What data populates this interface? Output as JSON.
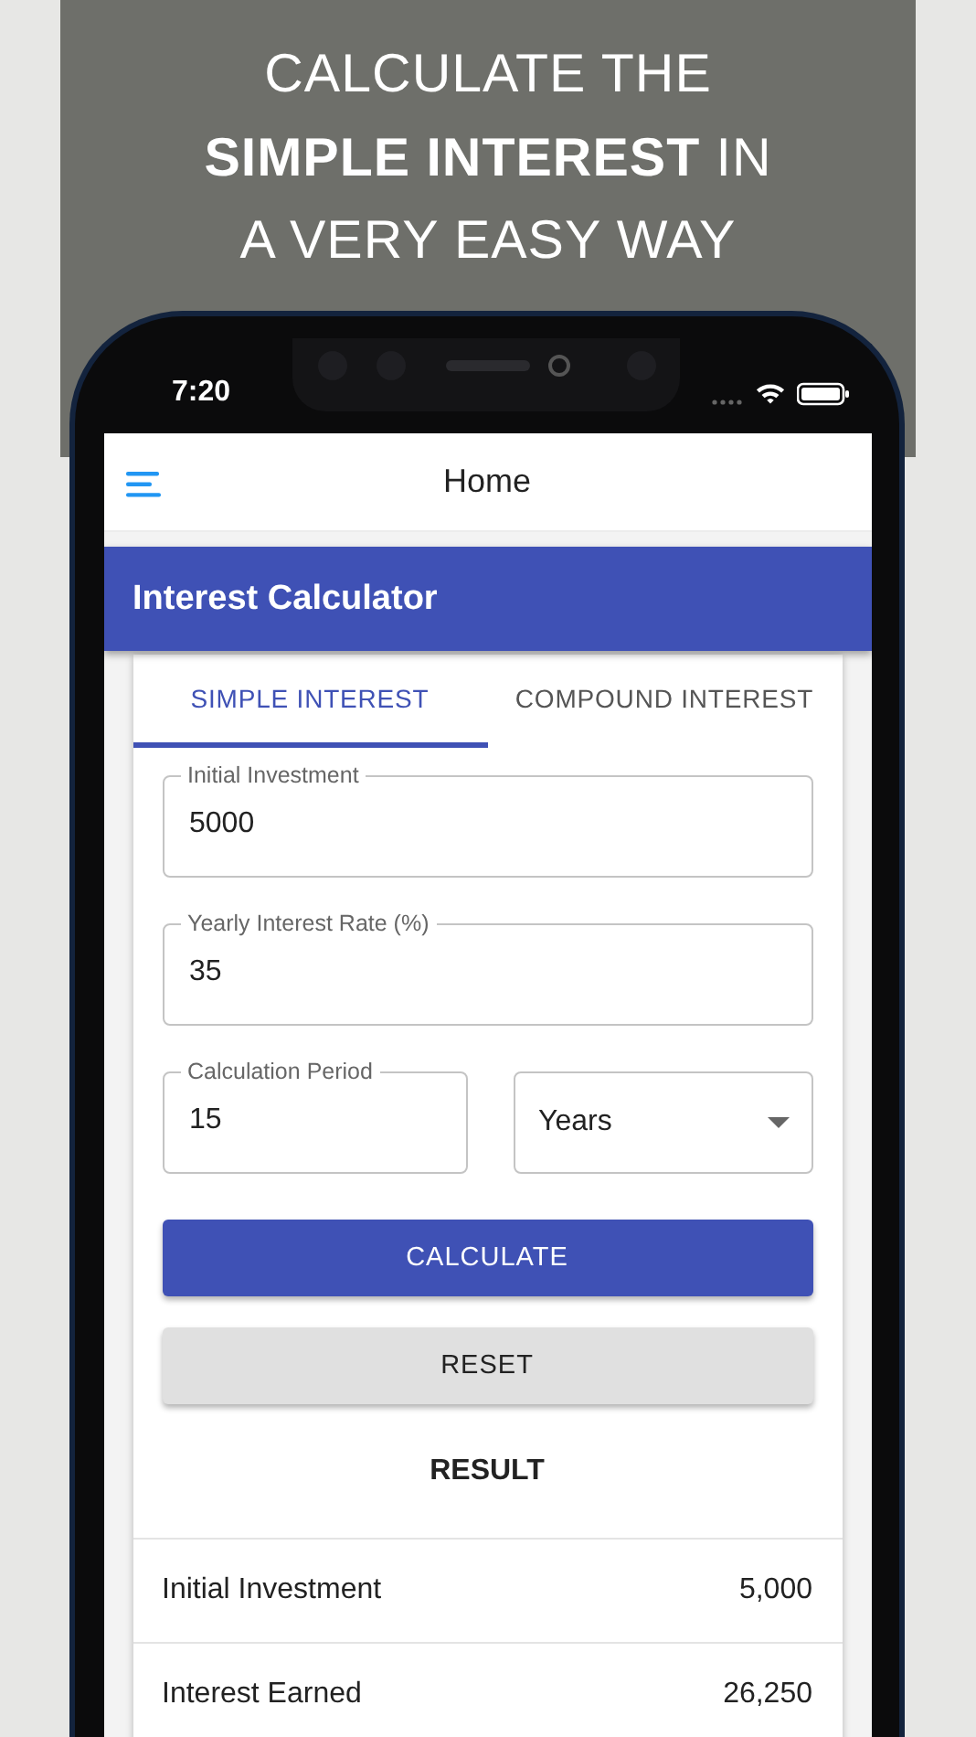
{
  "headline": [
    "CALCULATE THE",
    "**SIMPLE INTEREST** IN",
    "A VERY EASY WAY"
  ],
  "status_bar": {
    "time": "7:20"
  },
  "app_bar": {
    "title": "Home"
  },
  "header": {
    "title": "Interest Calculator"
  },
  "tabs": [
    {
      "label": "SIMPLE INTEREST",
      "selected": true
    },
    {
      "label": "COMPOUND INTEREST",
      "selected": false
    }
  ],
  "form_rows": [
    [
      {
        "kind": "text",
        "label": "Initial Investment",
        "value": "5000"
      }
    ],
    [
      {
        "kind": "text",
        "label": "Yearly Interest Rate (%)",
        "value": "35"
      }
    ],
    [
      {
        "kind": "text",
        "label": "Calculation Period",
        "value": "15"
      },
      {
        "kind": "select",
        "value": "Years"
      }
    ]
  ],
  "buttons": [
    {
      "kind": "primary",
      "label": "CALCULATE"
    },
    {
      "kind": "secondary",
      "label": "RESET"
    }
  ],
  "result": {
    "title": "RESULT",
    "rows": [
      {
        "label": "Initial Investment",
        "value": "5,000"
      },
      {
        "label": "Interest Earned",
        "value": "26,250"
      }
    ]
  }
}
